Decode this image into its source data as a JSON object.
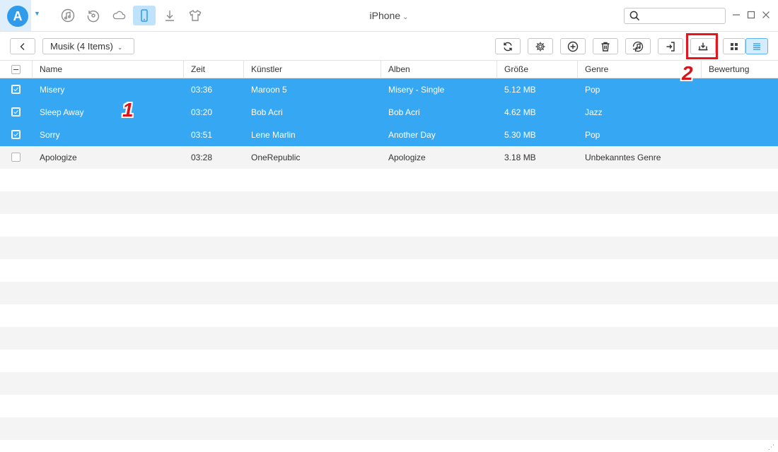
{
  "app": {
    "logo_letter": "A",
    "device_title": "iPhone"
  },
  "nav": {
    "items": [
      {
        "name": "music-library-icon",
        "active": false
      },
      {
        "name": "history-icon",
        "active": false
      },
      {
        "name": "cloud-icon",
        "active": false
      },
      {
        "name": "phone-icon",
        "active": true
      },
      {
        "name": "download-icon",
        "active": false
      },
      {
        "name": "tshirt-icon",
        "active": false
      }
    ]
  },
  "search": {
    "placeholder": "",
    "value": ""
  },
  "toolbar": {
    "category_label": "Musik (4 Items)",
    "buttons": [
      "refresh-icon",
      "settings-icon",
      "add-icon",
      "delete-icon",
      "itunes-icon",
      "to-device-icon",
      "to-computer-icon"
    ],
    "view_modes": [
      "grid-view-icon",
      "list-view-icon"
    ],
    "active_view": "list"
  },
  "annotations": {
    "marker_1": "1",
    "marker_2": "2",
    "highlight_color": "#e5151e"
  },
  "table": {
    "headers": {
      "name": "Name",
      "time": "Zeit",
      "artist": "Künstler",
      "album": "Alben",
      "size": "Größe",
      "genre": "Genre",
      "rating": "Bewertung"
    },
    "rows": [
      {
        "name": "Misery",
        "time": "03:36",
        "artist": "Maroon 5",
        "album": "Misery - Single",
        "size": "5.12 MB",
        "genre": "Pop",
        "rating": "",
        "checked": true
      },
      {
        "name": "Sleep Away",
        "time": "03:20",
        "artist": "Bob Acri",
        "album": "Bob Acri",
        "size": "4.62 MB",
        "genre": "Jazz",
        "rating": "",
        "checked": true
      },
      {
        "name": "Sorry",
        "time": "03:51",
        "artist": "Lene Marlin",
        "album": "Another Day",
        "size": "5.30 MB",
        "genre": "Pop",
        "rating": "",
        "checked": true
      },
      {
        "name": "Apologize",
        "time": "03:28",
        "artist": "OneRepublic",
        "album": "Apologize",
        "size": "3.18 MB",
        "genre": "Unbekanntes Genre",
        "rating": "",
        "checked": false
      }
    ]
  },
  "colors": {
    "selected_row": "#36a8f3",
    "accent": "#2f9bea",
    "alt_row": "#f4f4f4"
  }
}
